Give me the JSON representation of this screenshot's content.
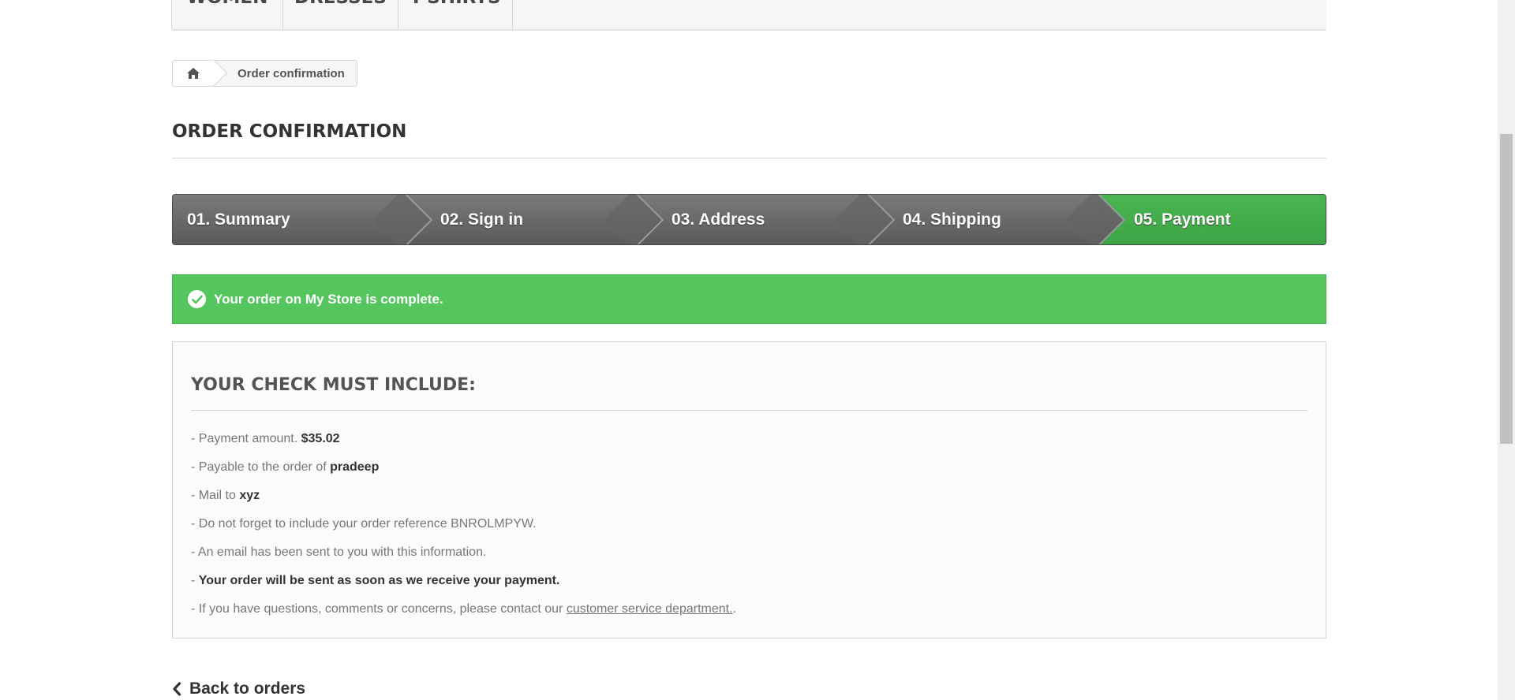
{
  "menu": {
    "items": [
      {
        "label": "WOMEN"
      },
      {
        "label": "DRESSES"
      },
      {
        "label": "T-SHIRTS"
      }
    ]
  },
  "breadcrumb": {
    "home_icon": "home-icon",
    "current": "Order confirmation"
  },
  "page_heading": "ORDER CONFIRMATION",
  "steps": [
    {
      "label": "01. Summary",
      "state": "done"
    },
    {
      "label": "02. Sign in",
      "state": "done"
    },
    {
      "label": "03. Address",
      "state": "done"
    },
    {
      "label": "04. Shipping",
      "state": "done"
    },
    {
      "label": "05. Payment",
      "state": "current"
    }
  ],
  "alert": {
    "icon": "check-circle-icon",
    "message": "Your order on My Store is complete."
  },
  "check_box": {
    "title": "YOUR CHECK MUST INCLUDE:",
    "payment_prefix": "- Payment amount.",
    "payment_amount": "$35.02",
    "payable_prefix": "- Payable to the order of",
    "payable_name": "pradeep",
    "mail_prefix": "- Mail to",
    "mail_to": "xyz",
    "reference_line": "- Do not forget to include your order reference BNROLMPYW.",
    "email_line": "- An email has been sent to you with this information.",
    "dash": "-",
    "ship_line": "Your order will be sent as soon as we receive your payment.",
    "questions_prefix": "- If you have questions, comments or concerns, please contact our",
    "questions_link": "customer service department.",
    "questions_suffix": "."
  },
  "back_link": {
    "icon": "chevron-left-icon",
    "label": "Back to orders"
  },
  "colors": {
    "success": "#55c65e",
    "step_dark": "#666666",
    "step_active": "#46b04e"
  }
}
